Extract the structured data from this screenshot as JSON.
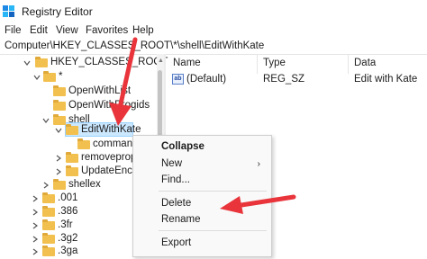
{
  "window": {
    "title": "Registry Editor"
  },
  "menu": [
    "File",
    "Edit",
    "View",
    "Favorites",
    "Help"
  ],
  "address": "Computer\\HKEY_CLASSES_ROOT\\*\\shell\\EditWithKate",
  "tree": {
    "hkcr": "HKEY_CLASSES_ROOT",
    "star": "*",
    "openwithlist": "OpenWithList",
    "openwithprogids": "OpenWithProgids",
    "shell": "shell",
    "editwithkate": "EditWithKate",
    "command": "command",
    "removeproperties": "removeproperties",
    "updateencryption": "UpdateEncryption",
    "shellex": "shellex",
    "ext001": ".001",
    "ext386": ".386",
    "ext3fr": ".3fr",
    "ext3g2": ".3g2",
    "ext3ga": ".3ga"
  },
  "columns": {
    "name": "Name",
    "type": "Type",
    "data": "Data"
  },
  "values": [
    {
      "name": "(Default)",
      "type": "REG_SZ",
      "data": "Edit with Kate"
    }
  ],
  "context_menu": {
    "collapse": "Collapse",
    "new": "New",
    "find": "Find...",
    "delete": "Delete",
    "rename": "Rename",
    "export": "Export"
  },
  "colors": {
    "annotation_arrow": "#e8343a",
    "folder": "#f2c04e",
    "selection": "#cce8ff"
  }
}
